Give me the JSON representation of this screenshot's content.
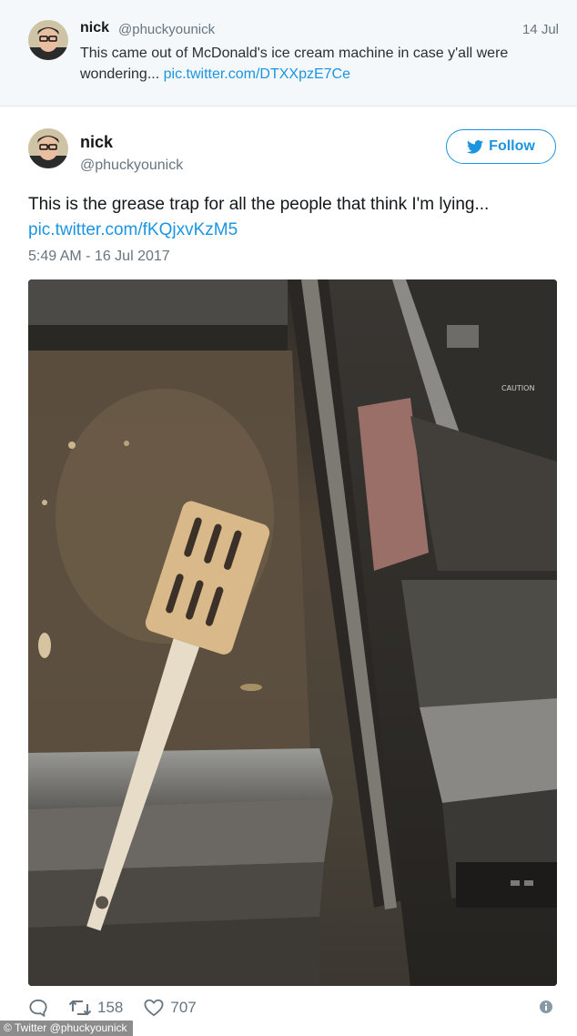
{
  "previous_tweet": {
    "name": "nick",
    "handle": "@phuckyounick",
    "date": "14 Jul",
    "text": "This came out of McDonald's ice cream machine in case y'all were wondering... ",
    "link": "pic.twitter.com/DTXXpzE7Ce"
  },
  "tweet": {
    "name": "nick",
    "handle": "@phuckyounick",
    "follow_label": "Follow",
    "text": "This is the grease trap for all the people that think I'm lying...",
    "link": "pic.twitter.com/fKQjxvKzM5",
    "timestamp": "5:49 AM - 16 Jul 2017",
    "retweets": "158",
    "likes": "707"
  },
  "photo": {
    "label_text": "CAUTION"
  },
  "credit": "© Twitter @phuckyounick",
  "icons": {
    "reply": "speech-bubble",
    "retweet": "retweet-arrows",
    "like": "heart",
    "info": "info-circle",
    "follow": "twitter-bird"
  },
  "colors": {
    "link": "#1b95e0",
    "muted": "#66757f",
    "quoted_bg": "#f5f8fa"
  }
}
